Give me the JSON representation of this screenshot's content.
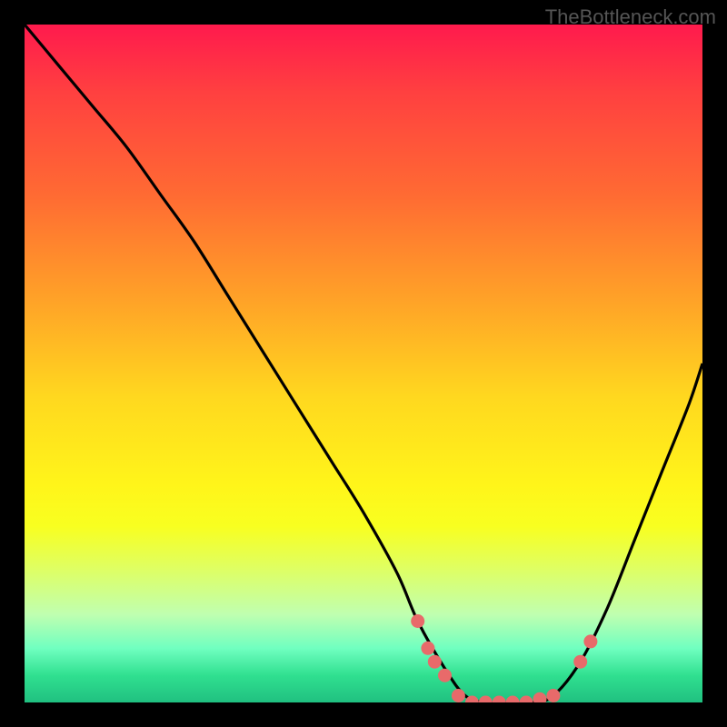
{
  "watermark": "TheBottleneck.com",
  "chart_data": {
    "type": "line",
    "title": "",
    "xlabel": "",
    "ylabel": "",
    "xlim": [
      0,
      100
    ],
    "ylim": [
      0,
      100
    ],
    "series": [
      {
        "name": "bottleneck-curve",
        "x": [
          0,
          5,
          10,
          15,
          20,
          25,
          30,
          35,
          40,
          45,
          50,
          55,
          58,
          62,
          65,
          68,
          72,
          75,
          78,
          82,
          86,
          90,
          94,
          98,
          100
        ],
        "y": [
          100,
          94,
          88,
          82,
          75,
          68,
          60,
          52,
          44,
          36,
          28,
          19,
          12,
          5,
          1,
          0,
          0,
          0,
          1,
          6,
          14,
          24,
          34,
          44,
          50
        ]
      }
    ],
    "markers": {
      "name": "highlight-dots",
      "color": "#e86a6a",
      "points": [
        {
          "x": 58,
          "y": 12
        },
        {
          "x": 59.5,
          "y": 8
        },
        {
          "x": 60.5,
          "y": 6
        },
        {
          "x": 62,
          "y": 4
        },
        {
          "x": 64,
          "y": 1
        },
        {
          "x": 66,
          "y": 0
        },
        {
          "x": 68,
          "y": 0
        },
        {
          "x": 70,
          "y": 0
        },
        {
          "x": 72,
          "y": 0
        },
        {
          "x": 74,
          "y": 0
        },
        {
          "x": 76,
          "y": 0.5
        },
        {
          "x": 78,
          "y": 1
        },
        {
          "x": 82,
          "y": 6
        },
        {
          "x": 83.5,
          "y": 9
        }
      ]
    }
  }
}
